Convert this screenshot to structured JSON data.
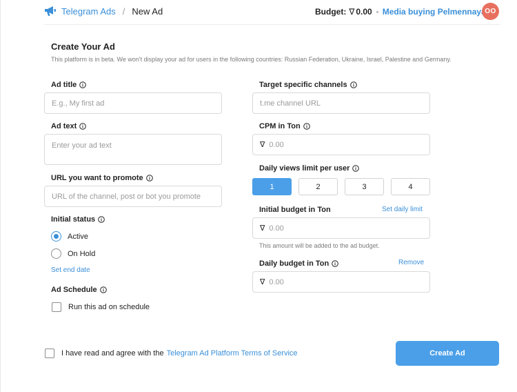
{
  "header": {
    "brand": "Telegram Ads",
    "separator": "/",
    "crumb": "New Ad",
    "budget_label": "Budget:",
    "budget_symbol": "∇",
    "budget_value": "0.00",
    "account_name": "Media buying Pelmennaya",
    "avatar_initials": "OO"
  },
  "form": {
    "title": "Create Your Ad",
    "notice": "This platform is in beta. We won't display your ad for users in the following countries: Russian Federation, Ukraine, Israel, Palestine and Germany.",
    "ad_title": {
      "label": "Ad title",
      "placeholder": "E.g., My first ad",
      "value": ""
    },
    "ad_text": {
      "label": "Ad text",
      "placeholder": "Enter your ad text",
      "value": ""
    },
    "url": {
      "label": "URL you want to promote",
      "placeholder": "URL of the channel, post or bot you promote",
      "value": ""
    },
    "status": {
      "label": "Initial status",
      "options": [
        {
          "label": "Active",
          "selected": true
        },
        {
          "label": "On Hold",
          "selected": false
        }
      ],
      "set_end_date": "Set end date"
    },
    "schedule": {
      "label": "Ad Schedule",
      "checkbox_label": "Run this ad on schedule",
      "checked": false
    },
    "channels": {
      "label": "Target specific channels",
      "placeholder": "t.me channel URL"
    },
    "cpm": {
      "label": "CPM in Ton",
      "symbol": "∇",
      "placeholder": "0.00"
    },
    "daily_views": {
      "label": "Daily views limit per user",
      "options": [
        "1",
        "2",
        "3",
        "4"
      ],
      "selected": "1"
    },
    "initial_budget": {
      "label": "Initial budget in Ton",
      "link": "Set daily limit",
      "symbol": "∇",
      "placeholder": "0.00",
      "hint": "This amount will be added to the ad budget."
    },
    "daily_budget": {
      "label": "Daily budget in Ton",
      "link": "Remove",
      "symbol": "∇",
      "placeholder": "0.00"
    },
    "agree": {
      "text": "I have read and agree with the",
      "link": "Telegram Ad Platform Terms of Service",
      "checked": false
    },
    "submit_label": "Create Ad"
  },
  "colors": {
    "accent": "#3a8fd8",
    "button": "#4a9fe8",
    "avatar": "#e8705f"
  }
}
